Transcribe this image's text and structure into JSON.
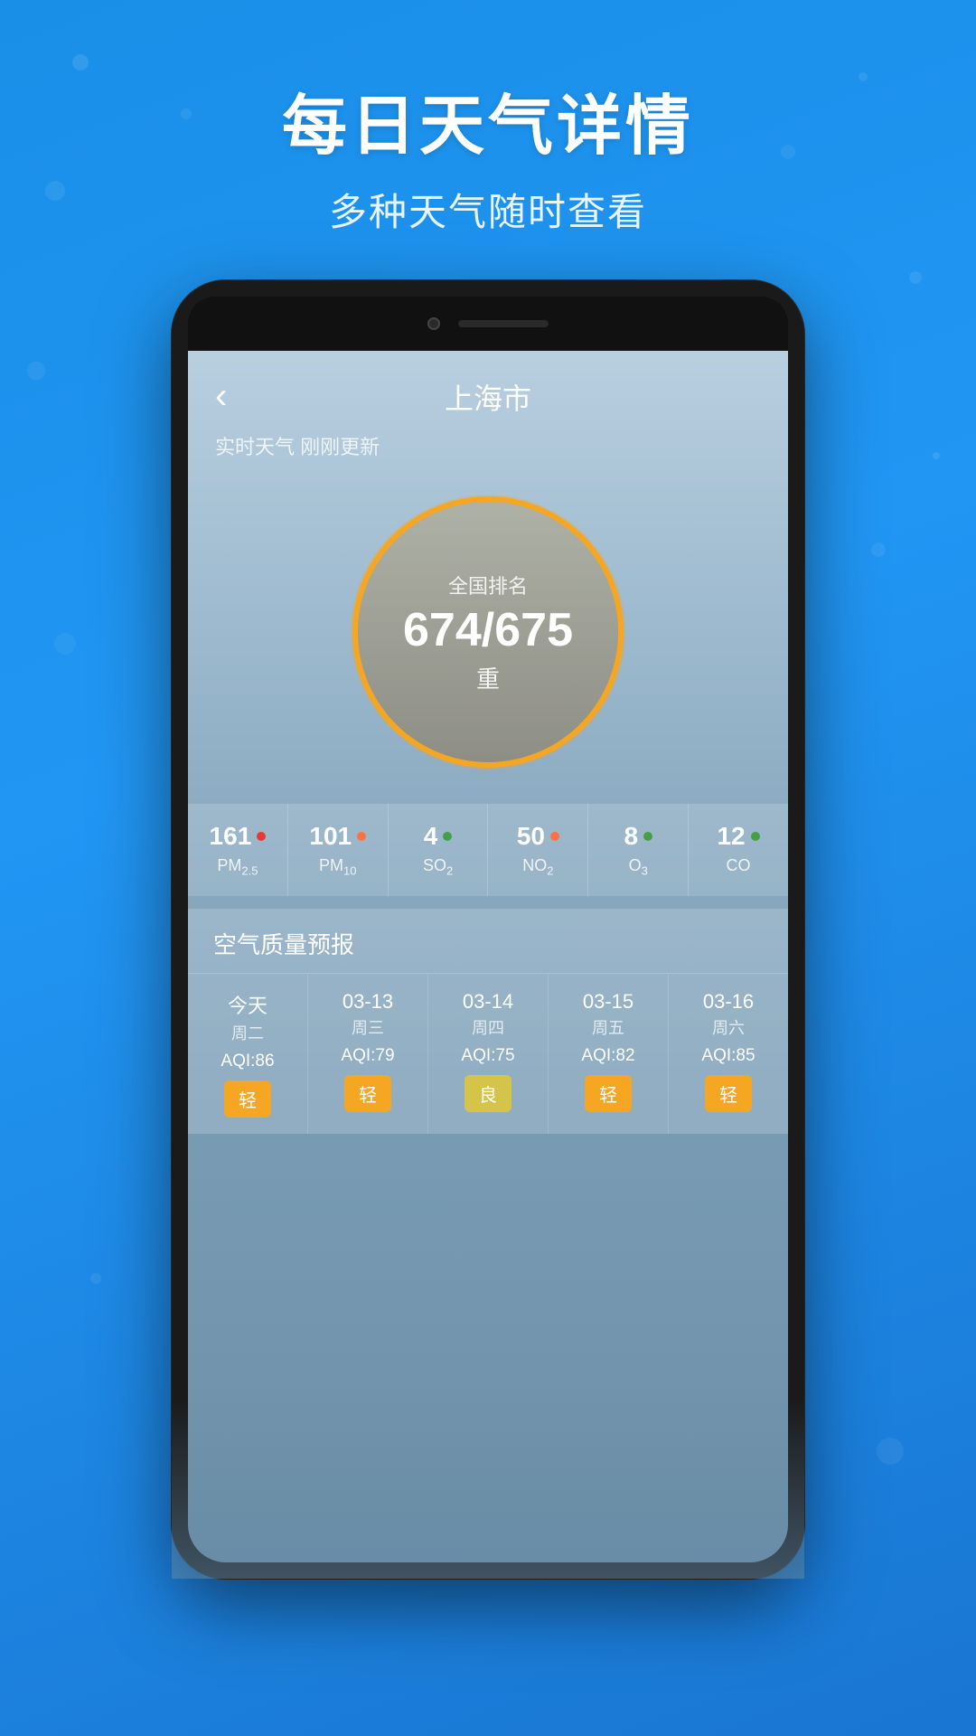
{
  "background": {
    "color": "#2196F3"
  },
  "header": {
    "title": "每日天气详情",
    "subtitle": "多种天气随时查看"
  },
  "app": {
    "back_label": "‹",
    "city_name": "上海市",
    "update_info": "实时天气 刚刚更新",
    "aqi_circle": {
      "label": "全国排名",
      "value": "674/675",
      "status": "重"
    },
    "pollutants": [
      {
        "value": "161",
        "dot_color": "red",
        "name": "PM",
        "sub": "2.5"
      },
      {
        "value": "101",
        "dot_color": "orange",
        "name": "PM",
        "sub": "10"
      },
      {
        "value": "4",
        "dot_color": "green",
        "name": "SO",
        "sub": "2"
      },
      {
        "value": "50",
        "dot_color": "orange",
        "name": "NO",
        "sub": "2"
      },
      {
        "value": "8",
        "dot_color": "green",
        "name": "O",
        "sub": "3"
      },
      {
        "value": "12",
        "dot_color": "green",
        "name": "CO",
        "sub": ""
      }
    ],
    "forecast_title": "空气质量预报",
    "forecast": [
      {
        "day": "今天",
        "date": "",
        "weekday": "周二",
        "aqi": "AQI:86",
        "badge": "轻",
        "badge_type": "orange"
      },
      {
        "day": "03-13",
        "date": "",
        "weekday": "周三",
        "aqi": "AQI:79",
        "badge": "轻",
        "badge_type": "orange"
      },
      {
        "day": "03-14",
        "date": "",
        "weekday": "周四",
        "aqi": "AQI:75",
        "badge": "良",
        "badge_type": "yellow"
      },
      {
        "day": "03-15",
        "date": "",
        "weekday": "周五",
        "aqi": "AQI:82",
        "badge": "轻",
        "badge_type": "orange"
      },
      {
        "day": "03-16",
        "date": "",
        "weekday": "周六",
        "aqi": "AQI:85",
        "badge": "轻",
        "badge_type": "orange"
      }
    ]
  }
}
